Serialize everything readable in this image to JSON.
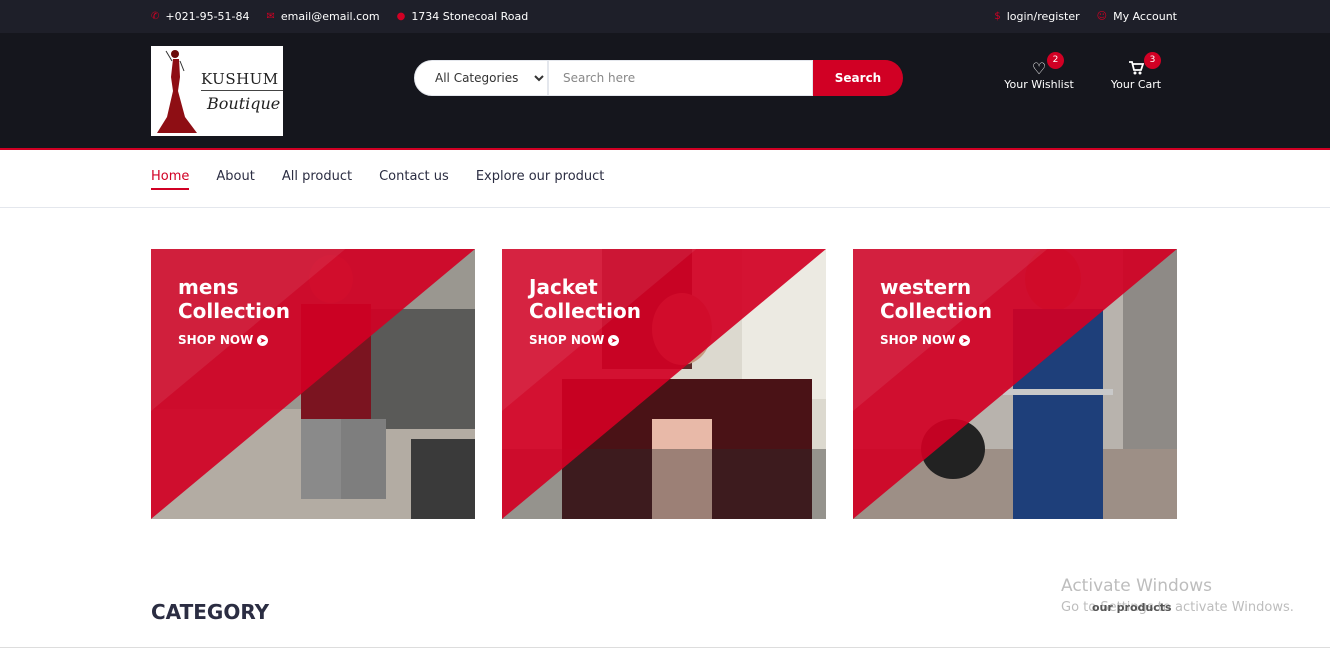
{
  "topbar": {
    "phone": "+021-95-51-84",
    "email": "email@email.com",
    "address": "1734 Stonecoal Road",
    "login": "login/register",
    "account": "My Account",
    "icons": [
      "phone-icon",
      "envelope-icon",
      "map-marker-icon",
      "dollar-icon",
      "user-icon"
    ]
  },
  "header": {
    "logo_line1": "KUSHUM",
    "logo_line2": "Boutique",
    "search": {
      "category_selected": "All Categories",
      "placeholder": "Search here",
      "button": "Search"
    },
    "wishlist": {
      "label": "Your Wishlist",
      "count": "2",
      "icon": "heart-icon"
    },
    "cart": {
      "label": "Your Cart",
      "count": "3",
      "icon": "cart-icon"
    }
  },
  "nav": {
    "items": [
      {
        "label": "Home",
        "active": true
      },
      {
        "label": "About"
      },
      {
        "label": "All product"
      },
      {
        "label": "Contact us"
      },
      {
        "label": "Explore our product"
      }
    ]
  },
  "collections": [
    {
      "line1": "mens",
      "line2": "Collection",
      "cta": "SHOP NOW"
    },
    {
      "line1": "Jacket",
      "line2": "Collection",
      "cta": "SHOP NOW"
    },
    {
      "line1": "western",
      "line2": "Collection",
      "cta": "SHOP NOW"
    }
  ],
  "section_title": "CATEGORY",
  "side_label": "our products",
  "watermark": {
    "line1": "Activate Windows",
    "line2": "Go to Settings to activate Windows."
  },
  "colors": {
    "accent": "#d10024",
    "dark": "#15161d",
    "topbar": "#1e1f29"
  }
}
